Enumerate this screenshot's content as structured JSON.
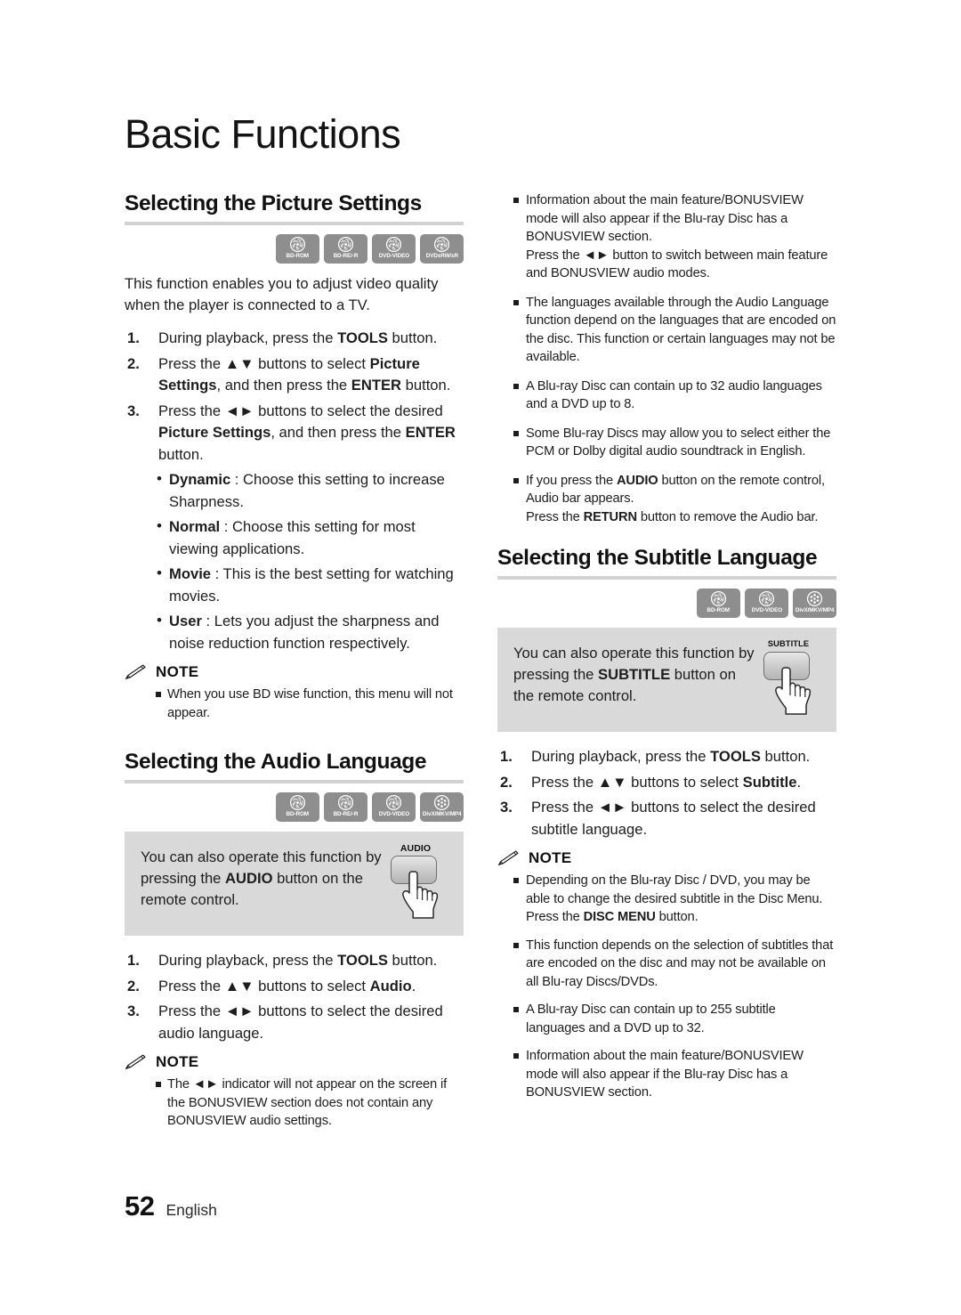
{
  "chapter_title": "Basic Functions",
  "footer": {
    "page_number": "52",
    "language": "English"
  },
  "note_label": "NOTE",
  "sections": {
    "picture": {
      "heading": "Selecting the Picture Settings",
      "discs": [
        "BD-ROM",
        "BD-RE/-R",
        "DVD-VIDEO",
        "DVD±RW/±R"
      ],
      "intro": "This function enables you to adjust video quality when the player is connected to a TV.",
      "steps": [
        {
          "num": "1.",
          "parts": [
            {
              "t": "During playback, press the ",
              "b": false
            },
            {
              "t": "TOOLS",
              "b": true
            },
            {
              "t": " button.",
              "b": false
            }
          ]
        },
        {
          "num": "2.",
          "parts": [
            {
              "t": "Press the ▲▼ buttons to select ",
              "b": false
            },
            {
              "t": "Picture Settings",
              "b": true
            },
            {
              "t": ", and then press the ",
              "b": false
            },
            {
              "t": "ENTER",
              "b": true
            },
            {
              "t": " button.",
              "b": false
            }
          ]
        },
        {
          "num": "3.",
          "parts": [
            {
              "t": "Press the ◄► buttons to select the desired ",
              "b": false
            },
            {
              "t": "Picture Settings",
              "b": true
            },
            {
              "t": ", and then press the ",
              "b": false
            },
            {
              "t": "ENTER",
              "b": true
            },
            {
              "t": " button.",
              "b": false
            }
          ]
        }
      ],
      "options": [
        {
          "name": "Dynamic",
          "desc": " : Choose this setting to increase Sharpness."
        },
        {
          "name": "Normal",
          "desc": " : Choose this setting for most viewing applications."
        },
        {
          "name": "Movie",
          "desc": " : This is the best setting for watching movies."
        },
        {
          "name": "User",
          "desc": " : Lets you adjust the sharpness and noise reduction function respectively."
        }
      ],
      "notes": [
        "When you use BD wise function, this menu will not appear."
      ]
    },
    "audio": {
      "heading": "Selecting the Audio Language",
      "discs": [
        "BD-ROM",
        "BD-RE/-R",
        "DVD-VIDEO",
        "DivX/MKV/MP4"
      ],
      "callout": {
        "parts": [
          {
            "t": "You can also operate this function by pressing the ",
            "b": false
          },
          {
            "t": "AUDIO",
            "b": true
          },
          {
            "t": " button on the remote control.",
            "b": false
          }
        ],
        "button_label": "AUDIO"
      },
      "steps": [
        {
          "num": "1.",
          "parts": [
            {
              "t": "During playback, press the ",
              "b": false
            },
            {
              "t": "TOOLS",
              "b": true
            },
            {
              "t": " button.",
              "b": false
            }
          ]
        },
        {
          "num": "2.",
          "parts": [
            {
              "t": "Press the ▲▼ buttons to select ",
              "b": false
            },
            {
              "t": "Audio",
              "b": true
            },
            {
              "t": ".",
              "b": false
            }
          ]
        },
        {
          "num": "3.",
          "parts": [
            {
              "t": "Press the ◄► buttons to select the desired audio language.",
              "b": false
            }
          ]
        }
      ],
      "notes_left": [
        "The ◄► indicator will not appear on the screen if the BONUSVIEW section does not contain any BONUSVIEW audio settings."
      ],
      "notes_right": [
        [
          {
            "t": "Information about the main feature/BONUSVIEW mode will also appear if the Blu-ray Disc has a BONUSVIEW section.",
            "b": false
          },
          {
            "t": "\nPress the ◄► button to switch between main feature and BONUSVIEW audio modes.",
            "b": false
          }
        ],
        [
          {
            "t": "The languages available through the Audio Language function depend on the languages that are encoded on the disc. This function or certain languages may not be available.",
            "b": false
          }
        ],
        [
          {
            "t": "A Blu-ray Disc can contain up to 32 audio languages and a DVD up to 8.",
            "b": false
          }
        ],
        [
          {
            "t": "Some Blu-ray Discs may allow you to select either the PCM or Dolby digital audio soundtrack in English.",
            "b": false
          }
        ],
        [
          {
            "t": "If you press the ",
            "b": false
          },
          {
            "t": "AUDIO",
            "b": true
          },
          {
            "t": " button on the remote control, Audio bar appears.",
            "b": false
          },
          {
            "t": "\nPress the ",
            "b": false
          },
          {
            "t": "RETURN",
            "b": true
          },
          {
            "t": " button to remove the Audio bar.",
            "b": false
          }
        ]
      ]
    },
    "subtitle": {
      "heading": "Selecting the Subtitle Language",
      "discs": [
        "BD-ROM",
        "DVD-VIDEO",
        "DivX/MKV/MP4"
      ],
      "callout": {
        "parts": [
          {
            "t": "You can also operate this function by pressing the ",
            "b": false
          },
          {
            "t": "SUBTITLE",
            "b": true
          },
          {
            "t": " button on the remote control.",
            "b": false
          }
        ],
        "button_label": "SUBTITLE"
      },
      "steps": [
        {
          "num": "1.",
          "parts": [
            {
              "t": "During playback, press the ",
              "b": false
            },
            {
              "t": "TOOLS",
              "b": true
            },
            {
              "t": " button.",
              "b": false
            }
          ]
        },
        {
          "num": "2.",
          "parts": [
            {
              "t": "Press the ▲▼ buttons to select ",
              "b": false
            },
            {
              "t": "Subtitle",
              "b": true
            },
            {
              "t": ".",
              "b": false
            }
          ]
        },
        {
          "num": "3.",
          "parts": [
            {
              "t": "Press the ◄► buttons to select the desired subtitle language.",
              "b": false
            }
          ]
        }
      ],
      "notes": [
        [
          {
            "t": "Depending on the Blu-ray Disc / DVD, you may be able to change the desired subtitle in the Disc Menu. Press the ",
            "b": false
          },
          {
            "t": "DISC MENU",
            "b": true
          },
          {
            "t": " button.",
            "b": false
          }
        ],
        [
          {
            "t": "This function depends on the selection of subtitles that are encoded on the disc and may not be available on all Blu-ray Discs/DVDs.",
            "b": false
          }
        ],
        [
          {
            "t": "A Blu-ray Disc can contain up to 255 subtitle languages and a DVD up to 32.",
            "b": false
          }
        ],
        [
          {
            "t": "Information about the main feature/BONUSVIEW mode will also appear if the Blu-ray Disc has a BONUSVIEW section.",
            "b": false
          }
        ]
      ]
    }
  },
  "colors": {
    "disc_badge": "#8e8e8e",
    "callout_bg": "#d9d9d9",
    "rule": "#d2d2d2",
    "text": "#1d1d1d"
  }
}
